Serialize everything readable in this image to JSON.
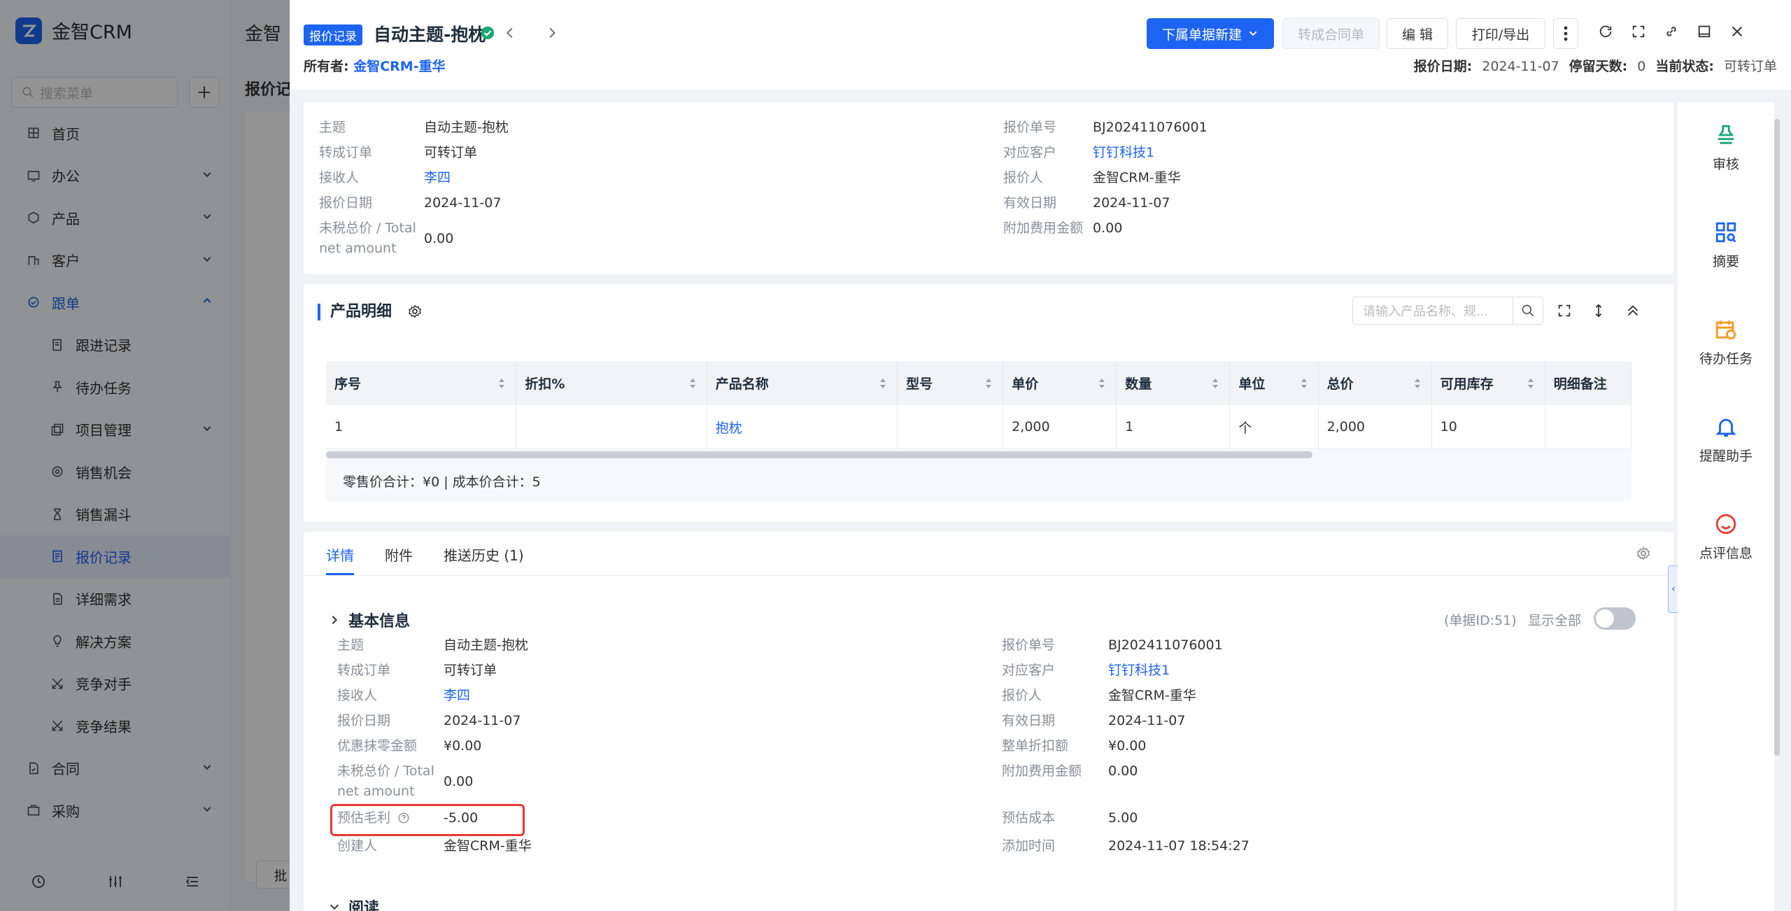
{
  "app": {
    "name": "金智CRM"
  },
  "sidebar": {
    "search_placeholder": "搜索菜单",
    "items": [
      {
        "label": "首页",
        "icon": "home-icon"
      },
      {
        "label": "办公",
        "icon": "office-icon"
      },
      {
        "label": "产品",
        "icon": "product-icon"
      },
      {
        "label": "客户",
        "icon": "customer-icon"
      },
      {
        "label": "跟单",
        "icon": "follow-icon"
      },
      {
        "label": "跟进记录",
        "icon": "record-icon"
      },
      {
        "label": "待办任务",
        "icon": "pin-icon"
      },
      {
        "label": "项目管理",
        "icon": "project-icon"
      },
      {
        "label": "销售机会",
        "icon": "target-icon"
      },
      {
        "label": "销售漏斗",
        "icon": "hourglass-icon"
      },
      {
        "label": "报价记录",
        "icon": "quote-icon"
      },
      {
        "label": "详细需求",
        "icon": "doc-icon"
      },
      {
        "label": "解决方案",
        "icon": "bulb-icon"
      },
      {
        "label": "竞争对手",
        "icon": "compete-icon"
      },
      {
        "label": "竞争结果",
        "icon": "compete-icon"
      },
      {
        "label": "合同",
        "icon": "contract-icon"
      },
      {
        "label": "采购",
        "icon": "purchase-icon"
      }
    ]
  },
  "background": {
    "title": "金智",
    "tab": "报价记",
    "batch_btn": "批"
  },
  "drawer": {
    "badge": "报价记录",
    "title": "自动主题-抱枕",
    "owner_label": "所有者:",
    "owner_value": "金智CRM-重华",
    "buttons": {
      "new_sub": "下属单据新建",
      "to_contract": "转成合同单",
      "edit": "编 辑",
      "print": "打印/导出"
    },
    "meta": {
      "date_label": "报价日期:",
      "date_value": "2024-11-07",
      "stay_label": "停留天数:",
      "stay_value": "0",
      "status_label": "当前状态:",
      "status_value": "可转订单"
    }
  },
  "summary": {
    "left": [
      {
        "label": "主题",
        "value": "自动主题-抱枕"
      },
      {
        "label": "转成订单",
        "value": "可转订单"
      },
      {
        "label": "接收人",
        "value": "李四",
        "link": true
      },
      {
        "label": "报价日期",
        "value": "2024-11-07"
      },
      {
        "label": "未税总价 / Total net amount",
        "value": "0.00"
      }
    ],
    "right": [
      {
        "label": "报价单号",
        "value": "BJ202411076001"
      },
      {
        "label": "对应客户",
        "value": "钉钉科技1",
        "link": true
      },
      {
        "label": "报价人",
        "value": "金智CRM-重华"
      },
      {
        "label": "有效日期",
        "value": "2024-11-07"
      },
      {
        "label": "附加费用金额",
        "value": "0.00"
      }
    ]
  },
  "products": {
    "title": "产品明细",
    "search_placeholder": "请输入产品名称、规...",
    "columns": [
      "序号",
      "折扣%",
      "产品名称",
      "型号",
      "单价",
      "数量",
      "单位",
      "总价",
      "可用库存",
      "明细备注"
    ],
    "rows": [
      [
        "1",
        "",
        "抱枕",
        "",
        "2,000",
        "1",
        "个",
        "2,000",
        "10",
        ""
      ]
    ],
    "totals": "零售价合计：¥0 |   成本价合计：5"
  },
  "detail": {
    "tabs": [
      "详情",
      "附件",
      "推送历史 (1)"
    ],
    "group": "基本信息",
    "doc_id": "(单据ID:51)",
    "show_all": "显示全部",
    "left": [
      {
        "label": "主题",
        "value": "自动主题-抱枕"
      },
      {
        "label": "转成订单",
        "value": "可转订单"
      },
      {
        "label": "接收人",
        "value": "李四",
        "link": true
      },
      {
        "label": "报价日期",
        "value": "2024-11-07"
      },
      {
        "label": "优惠抹零金额",
        "value": "¥0.00"
      },
      {
        "label": "未税总价 / Total net amount",
        "value": "0.00"
      },
      {
        "label": "预估毛利",
        "value": "-5.00"
      },
      {
        "label": "创建人",
        "value": "金智CRM-重华"
      }
    ],
    "right": [
      {
        "label": "报价单号",
        "value": "BJ202411076001"
      },
      {
        "label": "对应客户",
        "value": "钉钉科技1",
        "link": true
      },
      {
        "label": "报价人",
        "value": "金智CRM-重华"
      },
      {
        "label": "有效日期",
        "value": "2024-11-07"
      },
      {
        "label": "整单折扣额",
        "value": "¥0.00"
      },
      {
        "label": "附加费用金额",
        "value": "0.00"
      },
      {
        "label": "预估成本",
        "value": "5.00"
      },
      {
        "label": "添加时间",
        "value": "2024-11-07 18:54:27"
      }
    ],
    "next_group": "阅读"
  },
  "rail": [
    {
      "label": "审核",
      "color": "#19a974",
      "icon": "stamp-icon"
    },
    {
      "label": "摘要",
      "color": "#1d64f2",
      "icon": "summary-icon"
    },
    {
      "label": "待办任务",
      "color": "#f59a23",
      "icon": "calendar-icon"
    },
    {
      "label": "提醒助手",
      "color": "#1d64f2",
      "icon": "bell-icon"
    },
    {
      "label": "点评信息",
      "color": "#e53935",
      "icon": "smile-icon"
    }
  ],
  "colors": {
    "accent": "#1d64f2",
    "highlight": "#e53935"
  }
}
